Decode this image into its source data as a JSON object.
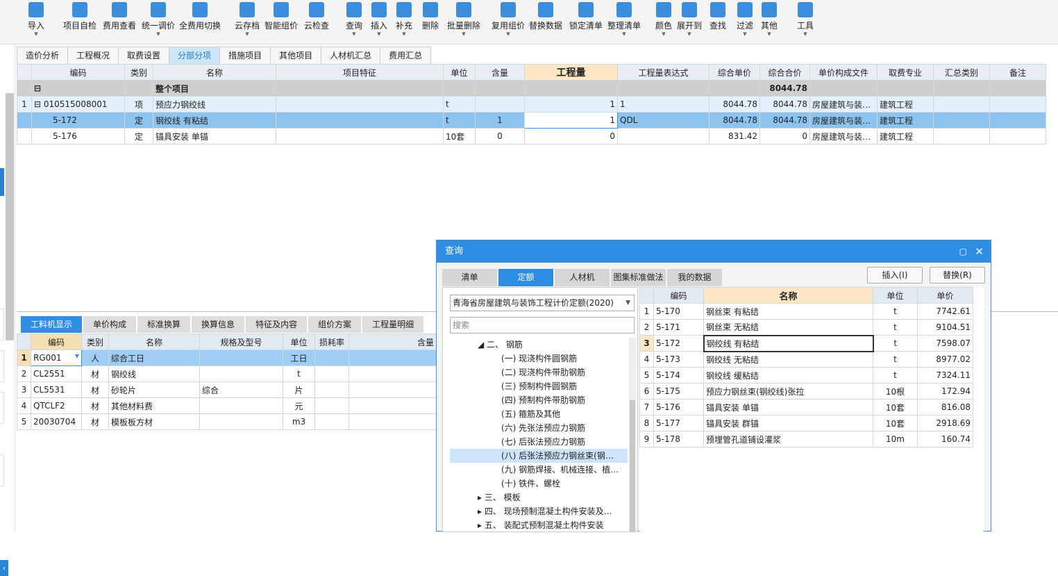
{
  "toolbar": [
    {
      "label": "导入",
      "icon": "import-icon",
      "dropdown": true
    },
    {
      "label": "项目自检",
      "icon": "project-check-icon",
      "dropdown": false
    },
    {
      "label": "费用查看",
      "icon": "fee-view-icon",
      "dropdown": false
    },
    {
      "label": "统一调价",
      "icon": "price-adjust-icon",
      "dropdown": true
    },
    {
      "label": "全费用切换",
      "icon": "full-fee-switch-icon",
      "dropdown": false
    },
    {
      "label": "云存档",
      "icon": "cloud-save-icon",
      "dropdown": true
    },
    {
      "label": "智能组价",
      "icon": "smart-pricing-icon",
      "dropdown": false
    },
    {
      "label": "云检查",
      "icon": "cloud-check-icon",
      "dropdown": false
    },
    {
      "label": "查询",
      "icon": "query-icon",
      "dropdown": true
    },
    {
      "label": "插入",
      "icon": "insert-icon",
      "dropdown": true
    },
    {
      "label": "补充",
      "icon": "supplement-icon",
      "dropdown": true
    },
    {
      "label": "删除",
      "icon": "delete-icon",
      "dropdown": false
    },
    {
      "label": "批量删除",
      "icon": "batch-delete-icon",
      "dropdown": true
    },
    {
      "label": "复用组价",
      "icon": "reuse-pricing-icon",
      "dropdown": true
    },
    {
      "label": "替换数据",
      "icon": "replace-data-icon",
      "dropdown": false
    },
    {
      "label": "锁定清单",
      "icon": "lock-icon",
      "dropdown": false
    },
    {
      "label": "整理清单",
      "icon": "organize-list-icon",
      "dropdown": true
    },
    {
      "label": "颜色",
      "icon": "color-icon",
      "dropdown": true
    },
    {
      "label": "展开到",
      "icon": "expand-to-icon",
      "dropdown": true
    },
    {
      "label": "查找",
      "icon": "find-icon",
      "dropdown": false
    },
    {
      "label": "过滤",
      "icon": "filter-icon",
      "dropdown": true
    },
    {
      "label": "其他",
      "icon": "other-icon",
      "dropdown": true
    },
    {
      "label": "工具",
      "icon": "tools-icon",
      "dropdown": true
    }
  ],
  "tabs": [
    "造价分析",
    "工程概况",
    "取费设置",
    "分部分项",
    "措施项目",
    "其他项目",
    "人材机汇总",
    "费用汇总"
  ],
  "main_headers": [
    "编码",
    "类别",
    "名称",
    "项目特征",
    "单位",
    "含量",
    "工程量",
    "工程量表达式",
    "综合单价",
    "综合合价",
    "单价构成文件",
    "取费专业",
    "汇总类别",
    "备注"
  ],
  "main_total": {
    "name": "整个项目",
    "amount": "8044.78"
  },
  "main_rows": [
    {
      "idx": "1",
      "code": "010515008001",
      "type": "项",
      "name": "预应力钢绞线",
      "unit": "t",
      "qty_per": "",
      "qty": "1",
      "expr": "1",
      "unit_price": "8044.78",
      "total": "8044.78",
      "file": "房屋建筑与装…",
      "major": "建筑工程"
    },
    {
      "idx": "",
      "code": "5-172",
      "type": "定",
      "name": "钢绞线 有粘结",
      "unit": "t",
      "qty_per": "1",
      "qty": "1",
      "expr": "QDL",
      "unit_price": "8044.78",
      "total": "8044.78",
      "file": "房屋建筑与装…",
      "major": "建筑工程"
    },
    {
      "idx": "",
      "code": "5-176",
      "type": "定",
      "name": "锚具安装 单锚",
      "unit": "10套",
      "qty_per": "0",
      "qty": "0",
      "expr": "",
      "unit_price": "831.42",
      "total": "0",
      "file": "房屋建筑与装…",
      "major": "建筑工程"
    }
  ],
  "bottom_tabs": [
    "工料机显示",
    "单价构成",
    "标准换算",
    "换算信息",
    "特征及内容",
    "组价方案",
    "工程量明细"
  ],
  "bottom_headers": [
    "编码",
    "类别",
    "名称",
    "规格及型号",
    "单位",
    "损耗率",
    "含量"
  ],
  "bottom_rows": [
    {
      "idx": "1",
      "code": "RG001",
      "type": "人",
      "name": "综合工日",
      "spec": "",
      "unit": "工日"
    },
    {
      "idx": "2",
      "code": "CL2551",
      "type": "材",
      "name": "钢绞线",
      "spec": "",
      "unit": "t"
    },
    {
      "idx": "3",
      "code": "CL5531",
      "type": "材",
      "name": "砂轮片",
      "spec": "综合",
      "unit": "片"
    },
    {
      "idx": "4",
      "code": "QTCLF2",
      "type": "材",
      "name": "其他材料费",
      "spec": "",
      "unit": "元"
    },
    {
      "idx": "5",
      "code": "20030704",
      "type": "材",
      "name": "模板板方材",
      "spec": "",
      "unit": "m3"
    }
  ],
  "dialog": {
    "title": "查询",
    "tabs": [
      "清单",
      "定额",
      "人材机",
      "图集标准做法",
      "我的数据"
    ],
    "insert_label": "插入(I)",
    "replace_label": "替换(R)",
    "quota_book": "青海省房屋建筑与装饰工程计价定额(2020)",
    "search_placeholder": "搜索",
    "tree": [
      {
        "text": "◢  二、 钢筋",
        "level": 0
      },
      {
        "text": "(一) 现浇构件圆钢筋",
        "level": 1
      },
      {
        "text": "(二) 现浇构件带肋钢筋",
        "level": 1
      },
      {
        "text": "(三) 预制构件圆钢筋",
        "level": 1
      },
      {
        "text": "(四) 预制构件带肋钢筋",
        "level": 1
      },
      {
        "text": "(五) 箍筋及其他",
        "level": 1
      },
      {
        "text": "(六) 先张法预应力钢筋",
        "level": 1
      },
      {
        "text": "(七) 后张法预应力钢筋",
        "level": 1
      },
      {
        "text": "(八) 后张法预应力钢丝束(钢…",
        "level": 1
      },
      {
        "text": "(九) 钢筋焊接、机械连接、植…",
        "level": 1
      },
      {
        "text": "(十) 铁件、螺栓",
        "level": 1
      },
      {
        "text": "▸  三、 模板",
        "level": 0
      },
      {
        "text": "▸  四、 现场预制混凝土构件安装及…",
        "level": 0
      },
      {
        "text": "▸  五、 装配式预制混凝土构件安装",
        "level": 0
      }
    ],
    "list_headers": [
      "编码",
      "名称",
      "单位",
      "单价"
    ],
    "list_rows": [
      {
        "idx": "1",
        "code": "5-170",
        "name": "钢丝束 有粘结",
        "unit": "t",
        "price": "7742.61"
      },
      {
        "idx": "2",
        "code": "5-171",
        "name": "钢丝束 无粘结",
        "unit": "t",
        "price": "9104.51"
      },
      {
        "idx": "3",
        "code": "5-172",
        "name": "钢绞线 有粘结",
        "unit": "t",
        "price": "7598.07"
      },
      {
        "idx": "4",
        "code": "5-173",
        "name": "钢绞线 无粘结",
        "unit": "t",
        "price": "8977.02"
      },
      {
        "idx": "5",
        "code": "5-174",
        "name": "钢绞线 缓粘结",
        "unit": "t",
        "price": "7324.11"
      },
      {
        "idx": "6",
        "code": "5-175",
        "name": "预应力钢丝束(钢绞线)张拉",
        "unit": "10根",
        "price": "172.94"
      },
      {
        "idx": "7",
        "code": "5-176",
        "name": "锚具安装 单锚",
        "unit": "10套",
        "price": "816.08"
      },
      {
        "idx": "8",
        "code": "5-177",
        "name": "锚具安装 群锚",
        "unit": "10套",
        "price": "2918.69"
      },
      {
        "idx": "9",
        "code": "5-178",
        "name": "预埋管孔道铺设灌浆",
        "unit": "10m",
        "price": "160.74"
      }
    ]
  }
}
